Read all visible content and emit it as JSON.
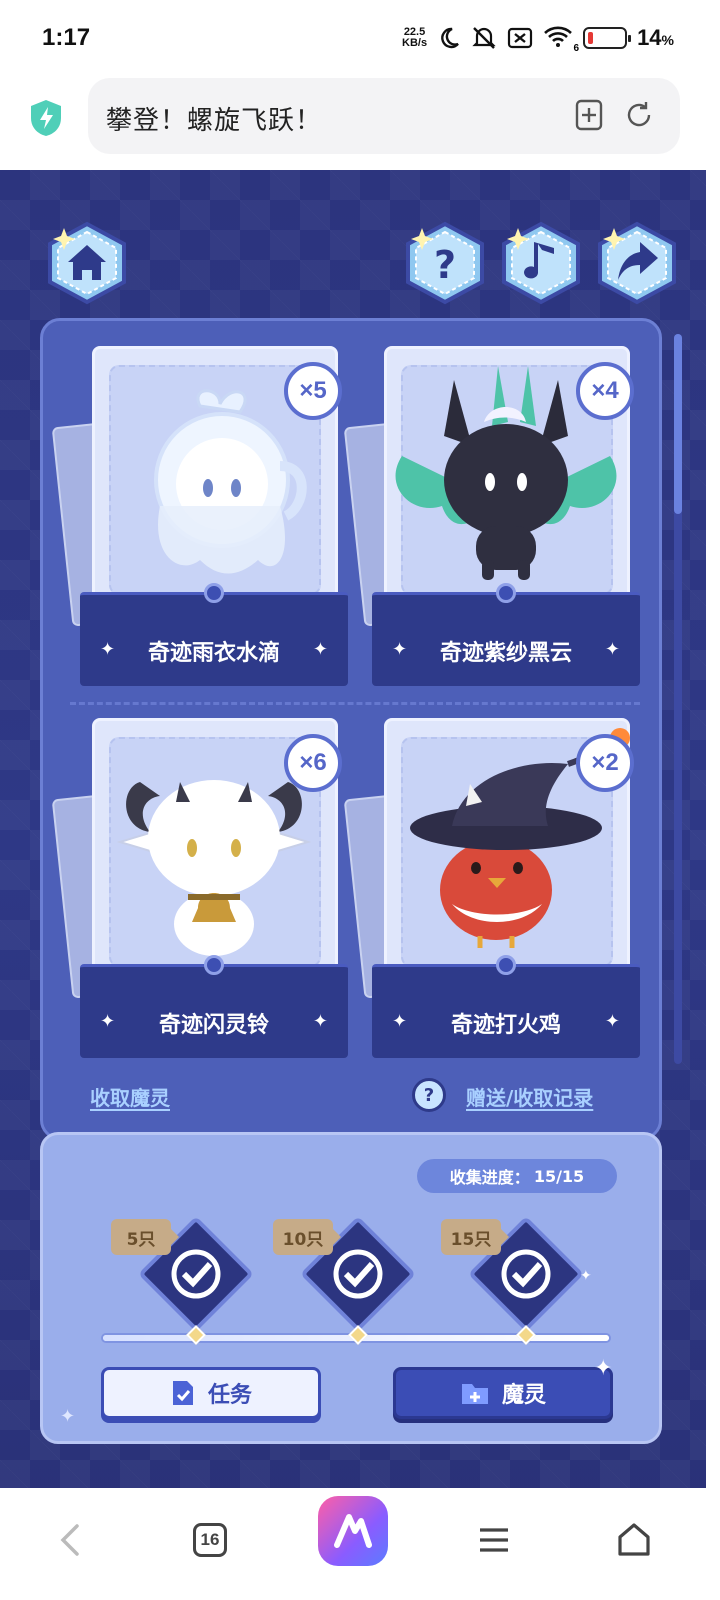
{
  "status_bar": {
    "time": "1:17",
    "net_speed_value": "22.5",
    "net_speed_unit": "KB/s",
    "icons": [
      "moon-icon",
      "mute-icon",
      "sim-off-icon",
      "wifi-icon"
    ],
    "wifi_badge": "6",
    "battery_percent": "14",
    "battery_level": 0.14,
    "battery_color": "#e53935"
  },
  "browser": {
    "page_title": "攀登！螺旋飞跃！",
    "add_tab_icon": "add-bookmark-icon",
    "reload_icon": "reload-icon",
    "shield_color": "#4fcfb8"
  },
  "game": {
    "top_buttons": [
      "home-icon",
      "help-icon",
      "music-icon",
      "share-icon"
    ],
    "cards": [
      {
        "name": "奇迹雨衣水滴",
        "count": "×5"
      },
      {
        "name": "奇迹紫纱黑云",
        "count": "×4"
      },
      {
        "name": "奇迹闪灵铃",
        "count": "×6"
      },
      {
        "name": "奇迹打火鸡",
        "count": "×2"
      }
    ],
    "collect_link": "收取魔灵",
    "history_link": "赠送/收取记录",
    "help_mark": "?",
    "progress_label": "收集进度：",
    "progress_value": "15/15",
    "progress_fraction": 1.0,
    "milestones": [
      {
        "label": "5只",
        "done": true
      },
      {
        "label": "10只",
        "done": true
      },
      {
        "label": "15只",
        "done": true
      }
    ],
    "task_button": "任务",
    "spirit_button": "魔灵",
    "accent": "#3b4db5"
  },
  "navbar": {
    "tab_count": "16",
    "items": [
      "back-icon",
      "tabs-icon",
      "app-logo-icon",
      "menu-icon",
      "home-icon"
    ]
  }
}
